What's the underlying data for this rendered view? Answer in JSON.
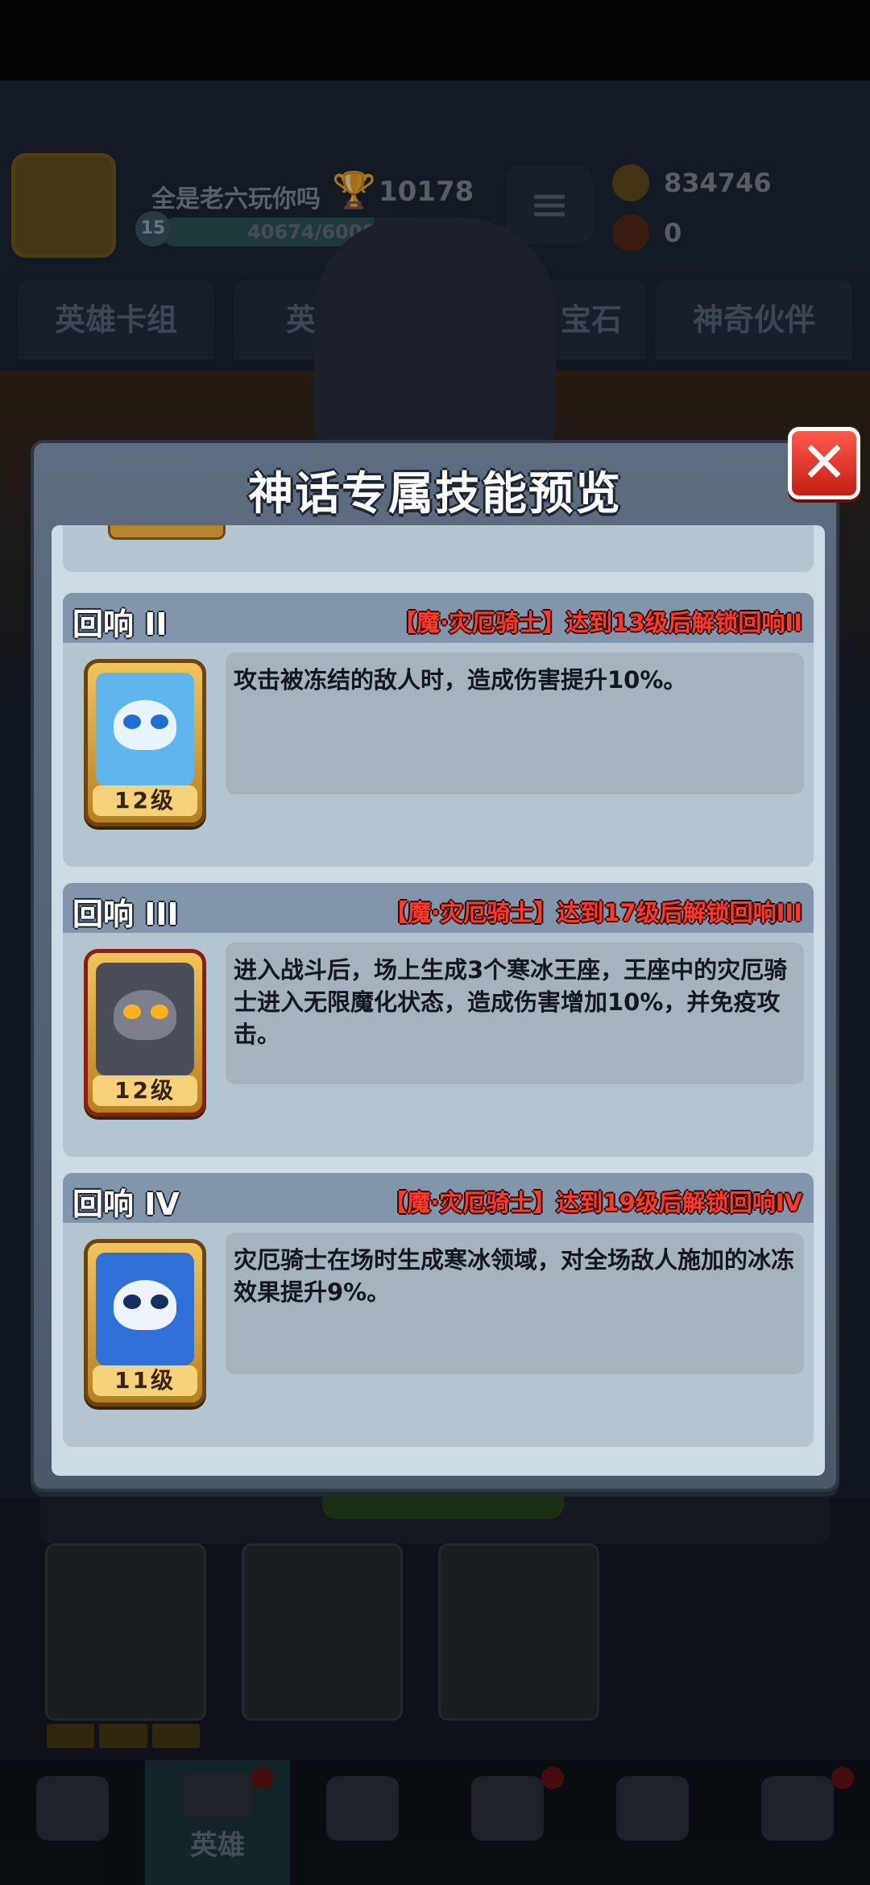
{
  "background": {
    "player_name": "全是老六玩你吗",
    "player_level": "15",
    "trophies": "10178",
    "xp_text": "40674/60000",
    "xp_progress": 0.678,
    "coins": "834746",
    "gems": "0",
    "tabs": [
      "英雄卡组",
      "英雄武",
      "宝石",
      "神奇伙伴"
    ],
    "nav_active_label": "英雄"
  },
  "modal": {
    "title": "神话专属技能预览",
    "close_label": "✕",
    "echoes": [
      {
        "name": "回响 II",
        "unlock": "【魔·灾厄骑士】达到13级后解锁回响II",
        "hero_level": "12级",
        "hero_icon": "yeti-hero-icon",
        "description": "攻击被冻结的敌人时，造成伤害提升10%。"
      },
      {
        "name": "回响 III",
        "unlock": "【魔·灾厄骑士】达到17级后解锁回响III",
        "hero_level": "12级",
        "hero_icon": "dark-knight-hero-icon",
        "description": "进入战斗后，场上生成3个寒冰王座，王座中的灾厄骑士进入无限魔化状态，造成伤害增加10%，并免疫攻击。"
      },
      {
        "name": "回响 IV",
        "unlock": "【魔·灾厄骑士】达到19级后解锁回响IV",
        "hero_level": "11级",
        "hero_icon": "frost-king-hero-icon",
        "description": "灾厄骑士在场时生成寒冰领域，对全场敌人施加的冰冻效果提升9%。"
      }
    ]
  },
  "colors": {
    "unlock_text": "#ff3a2a",
    "close_button": "#e0302a",
    "card_header": "#8196ab",
    "card_body": "#b3c5d1",
    "hero_frame_gold": "#f2c45a"
  }
}
